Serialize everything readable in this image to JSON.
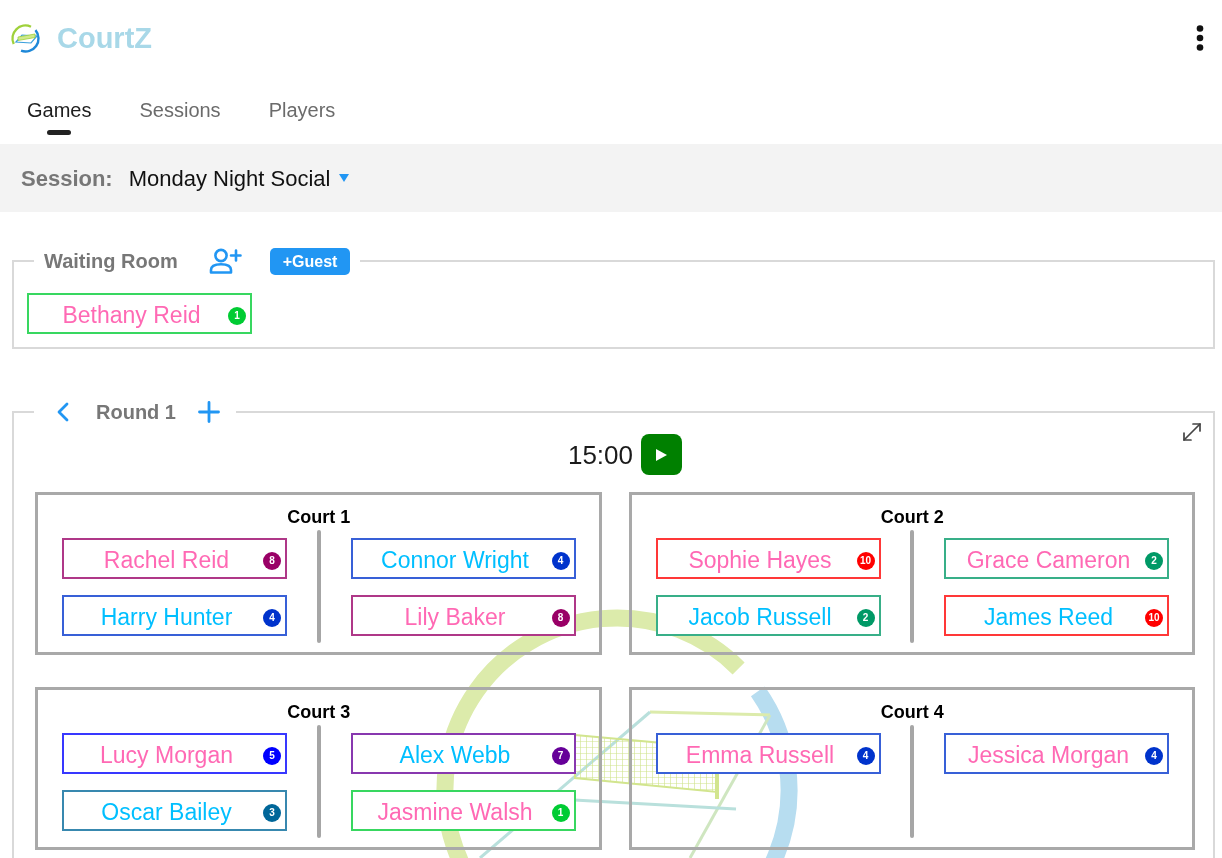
{
  "app": {
    "title": "CourtZ"
  },
  "tabs": [
    {
      "label": "Games",
      "selected": true
    },
    {
      "label": "Sessions",
      "selected": false
    },
    {
      "label": "Players",
      "selected": false
    }
  ],
  "session": {
    "label": "Session:",
    "value": "Monday Night Social"
  },
  "waiting_room": {
    "title": "Waiting Room",
    "guest_button": "+Guest",
    "players": [
      {
        "name": {
          "text": "Bethany Reid",
          "color": "#ff69b4"
        },
        "badge": {
          "text": "1",
          "color": "#00cc33"
        }
      }
    ]
  },
  "round": {
    "title": "Round 1",
    "timer": "15:00",
    "courts": [
      {
        "title": "Court 1",
        "teams": [
          {
            "players": [
              {
                "name": {
                  "text": "Rachel Reid",
                  "color": "#ff69b4"
                },
                "badge": {
                  "text": "8",
                  "color": "#990066"
                }
              },
              {
                "name": {
                  "text": "Harry Hunter",
                  "color": "#00bfff"
                },
                "badge": {
                  "text": "4",
                  "color": "#0033cc"
                }
              }
            ]
          },
          {
            "players": [
              {
                "name": {
                  "text": "Connor Wright",
                  "color": "#00bfff"
                },
                "badge": {
                  "text": "4",
                  "color": "#0033cc"
                }
              },
              {
                "name": {
                  "text": "Lily Baker",
                  "color": "#ff69b4"
                },
                "badge": {
                  "text": "8",
                  "color": "#990066"
                }
              }
            ]
          }
        ]
      },
      {
        "title": "Court 2",
        "teams": [
          {
            "players": [
              {
                "name": {
                  "text": "Sophie Hayes",
                  "color": "#ff69b4"
                },
                "badge": {
                  "text": "10",
                  "color": "#ff0000"
                }
              },
              {
                "name": {
                  "text": "Jacob Russell",
                  "color": "#00bfff"
                },
                "badge": {
                  "text": "2",
                  "color": "#009966"
                }
              }
            ]
          },
          {
            "players": [
              {
                "name": {
                  "text": "Grace Cameron",
                  "color": "#ff69b4"
                },
                "badge": {
                  "text": "2",
                  "color": "#009966"
                }
              },
              {
                "name": {
                  "text": "James Reed",
                  "color": "#00bfff"
                },
                "badge": {
                  "text": "10",
                  "color": "#ff0000"
                }
              }
            ]
          }
        ]
      },
      {
        "title": "Court 3",
        "teams": [
          {
            "players": [
              {
                "name": {
                  "text": "Lucy Morgan",
                  "color": "#ff69b4"
                },
                "badge": {
                  "text": "5",
                  "color": "#0000ff"
                }
              },
              {
                "name": {
                  "text": "Oscar Bailey",
                  "color": "#00bfff"
                },
                "badge": {
                  "text": "3",
                  "color": "#006699"
                }
              }
            ]
          },
          {
            "players": [
              {
                "name": {
                  "text": "Alex Webb",
                  "color": "#00bfff"
                },
                "badge": {
                  "text": "7",
                  "color": "#660099"
                }
              },
              {
                "name": {
                  "text": "Jasmine Walsh",
                  "color": "#ff69b4"
                },
                "badge": {
                  "text": "1",
                  "color": "#00cc33"
                }
              }
            ]
          }
        ]
      },
      {
        "title": "Court 4",
        "teams": [
          {
            "players": [
              {
                "name": {
                  "text": "Emma Russell",
                  "color": "#ff69b4"
                },
                "badge": {
                  "text": "4",
                  "color": "#0033cc"
                }
              }
            ]
          },
          {
            "players": [
              {
                "name": {
                  "text": "Jessica Morgan",
                  "color": "#ff69b4"
                },
                "badge": {
                  "text": "4",
                  "color": "#0033cc"
                }
              }
            ]
          }
        ]
      }
    ]
  }
}
